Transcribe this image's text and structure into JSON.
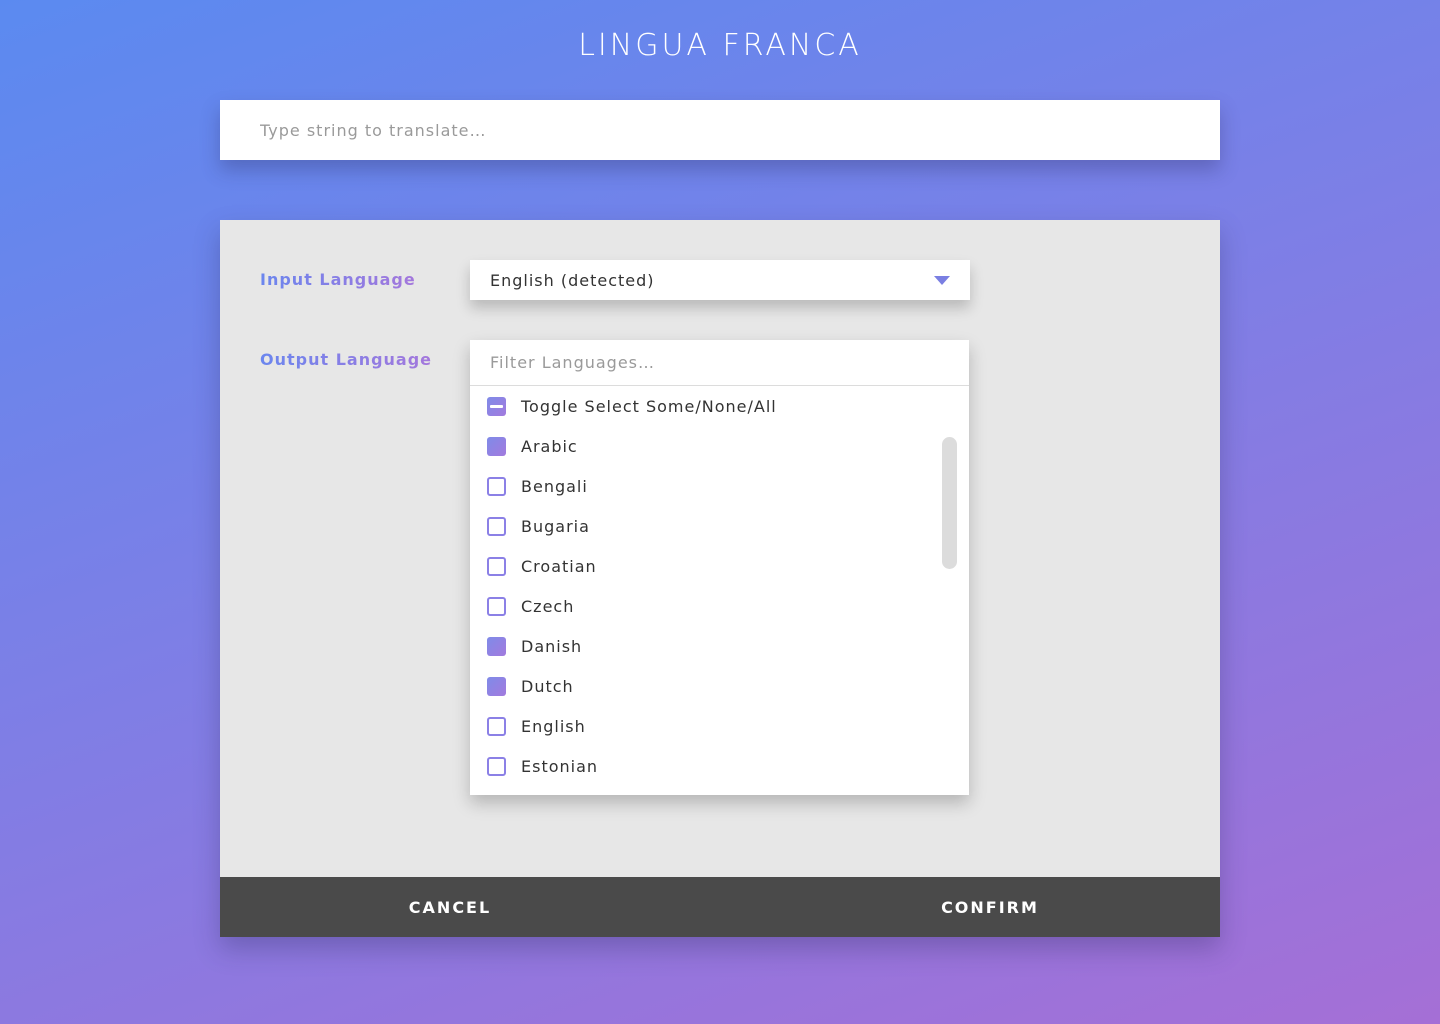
{
  "app": {
    "title": "LINGUA FRANCA"
  },
  "translate": {
    "placeholder": "Type string to translate…"
  },
  "input_language": {
    "label": "Input Language",
    "value": "English (detected)",
    "caret_icon": "caret-down-icon"
  },
  "output_language": {
    "label": "Output Language",
    "filter_placeholder": "Filter Languages…",
    "options": [
      {
        "label": "Toggle Select Some/None/All",
        "state": "partial"
      },
      {
        "label": "Arabic",
        "state": "checked"
      },
      {
        "label": "Bengali",
        "state": "unchecked"
      },
      {
        "label": "Bugaria",
        "state": "unchecked"
      },
      {
        "label": "Croatian",
        "state": "unchecked"
      },
      {
        "label": "Czech",
        "state": "unchecked"
      },
      {
        "label": "Danish",
        "state": "checked"
      },
      {
        "label": "Dutch",
        "state": "checked"
      },
      {
        "label": "English",
        "state": "unchecked"
      },
      {
        "label": "Estonian",
        "state": "unchecked"
      }
    ]
  },
  "footer": {
    "cancel_label": "CANCEL",
    "confirm_label": "CONFIRM"
  },
  "colors": {
    "accent_start": "#6b86ee",
    "accent_end": "#a477dc",
    "footer_bg": "#4a4a4a",
    "panel_bg": "#e7e7e7"
  }
}
